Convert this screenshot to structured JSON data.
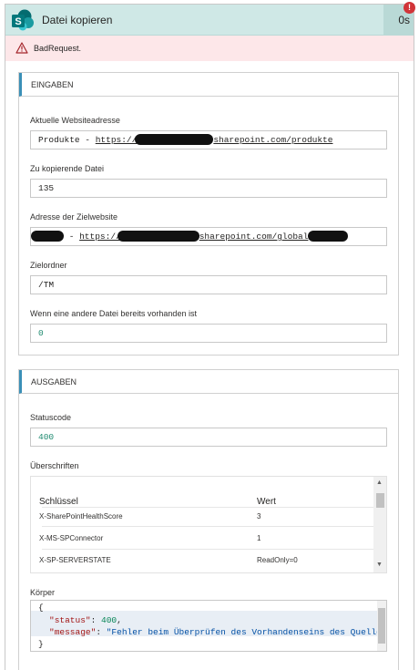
{
  "header": {
    "title": "Datei kopieren",
    "duration": "0s",
    "error_badge": "!",
    "icon": "sharepoint-icon",
    "color": "#cfe8e6"
  },
  "error": {
    "message": "BadRequest.",
    "icon": "warning-icon",
    "color": "#fde7e9"
  },
  "inputs": {
    "heading": "EINGABEN",
    "site_label": "Aktuelle Websiteadresse",
    "site_prefix": "Produkte - ",
    "site_url_start": "https://",
    "site_url_end": "sharepoint.com/produkte",
    "file_label": "Zu kopierende Datei",
    "file_value": "135",
    "dest_label": "Adresse der Zielwebsite",
    "dest_sep": " - ",
    "dest_url_start": "https://",
    "dest_url_end": "sharepoint.com/global",
    "folder_label": "Zielordner",
    "folder_value": "/TM",
    "conflict_label": "Wenn eine andere Datei bereits vorhanden ist",
    "conflict_value": "0"
  },
  "outputs": {
    "heading": "AUSGABEN",
    "status_label": "Statuscode",
    "status_value": "400",
    "headers_label": "Überschriften",
    "table": {
      "col_key": "Schlüssel",
      "col_value": "Wert",
      "rows": [
        {
          "key": "X-SharePointHealthScore",
          "value": "3"
        },
        {
          "key": "X-MS-SPConnector",
          "value": "1"
        },
        {
          "key": "X-SP-SERVERSTATE",
          "value": "ReadOnly=0"
        }
      ]
    },
    "body_label": "Körper",
    "body": {
      "open": "{",
      "status_key": "\"status\"",
      "status_val": "400",
      "message_key": "\"message\"",
      "message_val": "\"Fehler beim Überprüfen des Vorhandenseins des Quellob",
      "close": "}"
    }
  }
}
